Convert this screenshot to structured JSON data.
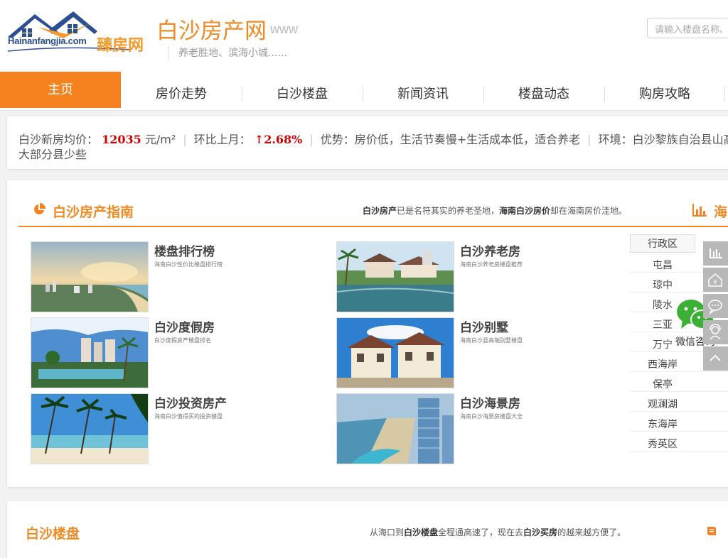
{
  "header": {
    "logo_text": "Hainanfangjia.com",
    "logo_cn": "臻房网",
    "site_title": "白沙房产网",
    "site_www": "www",
    "slogan": "养老胜地、滨海小城......",
    "search_placeholder": "请输入楼盘名称、"
  },
  "nav": {
    "home": "主页",
    "items": [
      "房价走势",
      "白沙楼盘",
      "新闻资讯",
      "楼盘动态",
      "购房攻略"
    ]
  },
  "info": {
    "price_label": "白沙新房均价：",
    "price_value": "12035",
    "price_unit": "元/m²",
    "mom_label": "环比上月：",
    "mom_value": "↑2.68%",
    "advantage": "优势：房价低，生活节奏慢+生活成本低，适合养老",
    "environment": "环境：白沙黎族自治县山高云雾",
    "environment_cont": "大部分县少些"
  },
  "guide": {
    "title": "白沙房产指南",
    "desc_b1": "白沙房产",
    "desc_t1": "已是名符其实的养老圣地，",
    "desc_b2": "海南白沙房价",
    "desc_t2": "却在海南房价洼地。",
    "right_title": "海",
    "cards": [
      {
        "title": "楼盘排行榜",
        "sub": "海南白沙性价比楼盘排行榜"
      },
      {
        "title": "白沙养老房",
        "sub": "海南白沙养老房楼盘推荐"
      },
      {
        "title": "白沙度假房",
        "sub": "白沙度假房产楼盘排名"
      },
      {
        "title": "白沙别墅",
        "sub": "海南白沙县高端别墅楼盘"
      },
      {
        "title": "白沙投资房产",
        "sub": "海南白沙值得买的投资楼盘"
      },
      {
        "title": "白沙海景房",
        "sub": "海南白沙海景房楼盘大全"
      }
    ]
  },
  "district": {
    "header": "行政区",
    "items": [
      "屯昌",
      "琼中",
      "陵水",
      "三亚",
      "万宁",
      "西海岸",
      "保亭",
      "观澜湖",
      "东海岸",
      "秀英区"
    ]
  },
  "float": {
    "wechat_label": "微信咨询"
  },
  "section2": {
    "title": "白沙楼盘",
    "desc_t1": "从海口到",
    "desc_b1": "白沙楼盘",
    "desc_t2": "全程通高速了，现在去",
    "desc_b2": "白沙买房",
    "desc_t3": "的越来越方便了。"
  },
  "colors": {
    "brand_orange": "#f5821f",
    "price_red": "#d40000"
  }
}
